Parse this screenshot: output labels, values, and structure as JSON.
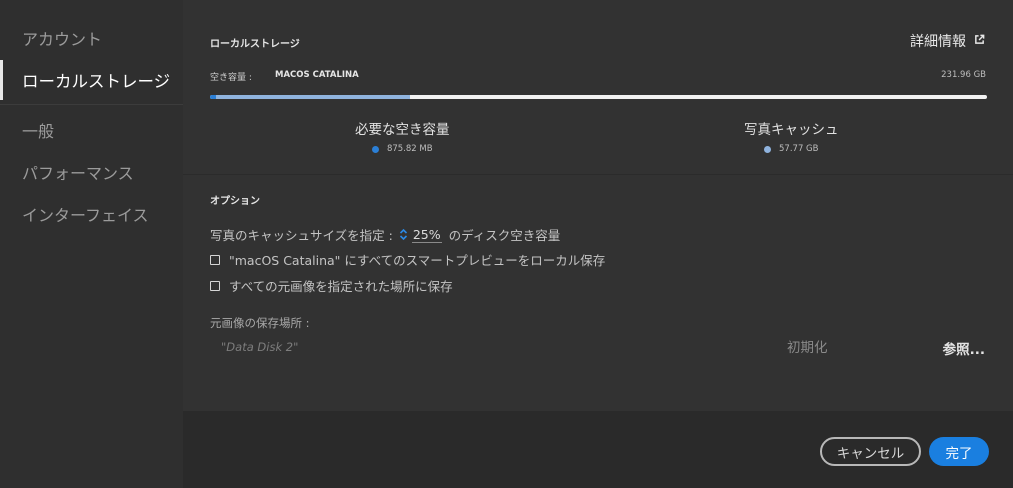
{
  "sidebar": {
    "items": [
      {
        "label": "アカウント",
        "active": false
      },
      {
        "label": "ローカルストレージ",
        "active": true
      },
      {
        "label": "一般",
        "active": false
      },
      {
        "label": "パフォーマンス",
        "active": false
      },
      {
        "label": "インターフェイス",
        "active": false
      }
    ]
  },
  "storage": {
    "section_title": "ローカルストレージ",
    "details_label": "詳細情報",
    "details_icon": "external-link-icon",
    "free_label": "空き容量 :",
    "disk_name": "MACOS CATALINA",
    "disk_size": "231.96 GB",
    "usage": {
      "required_fraction": 0.008,
      "cache_fraction": 0.25
    },
    "required": {
      "label": "必要な空き容量",
      "value": "875.82 MB",
      "color": "#2b7fd6"
    },
    "cache": {
      "label": "写真キャッシュ",
      "value": "57.77 GB",
      "color": "#8fb3de"
    }
  },
  "options": {
    "section_title": "オプション",
    "cache_size_prefix": "写真のキャッシュサイズを指定 :",
    "cache_size_value": "25%",
    "cache_size_suffix": "のディスク空き容量",
    "smart_preview_label": "\"macOS Catalina\" にすべてのスマートプレビューをローカル保存",
    "smart_preview_checked": false,
    "originals_label": "すべての元画像を指定された場所に保存",
    "originals_checked": false,
    "location_label": "元画像の保存場所 :",
    "location_value": "\"Data Disk 2\"",
    "reset_label": "初期化",
    "browse_label": "参照..."
  },
  "footer": {
    "cancel_label": "キャンセル",
    "done_label": "完了",
    "accent_color": "#1a7fe0"
  }
}
